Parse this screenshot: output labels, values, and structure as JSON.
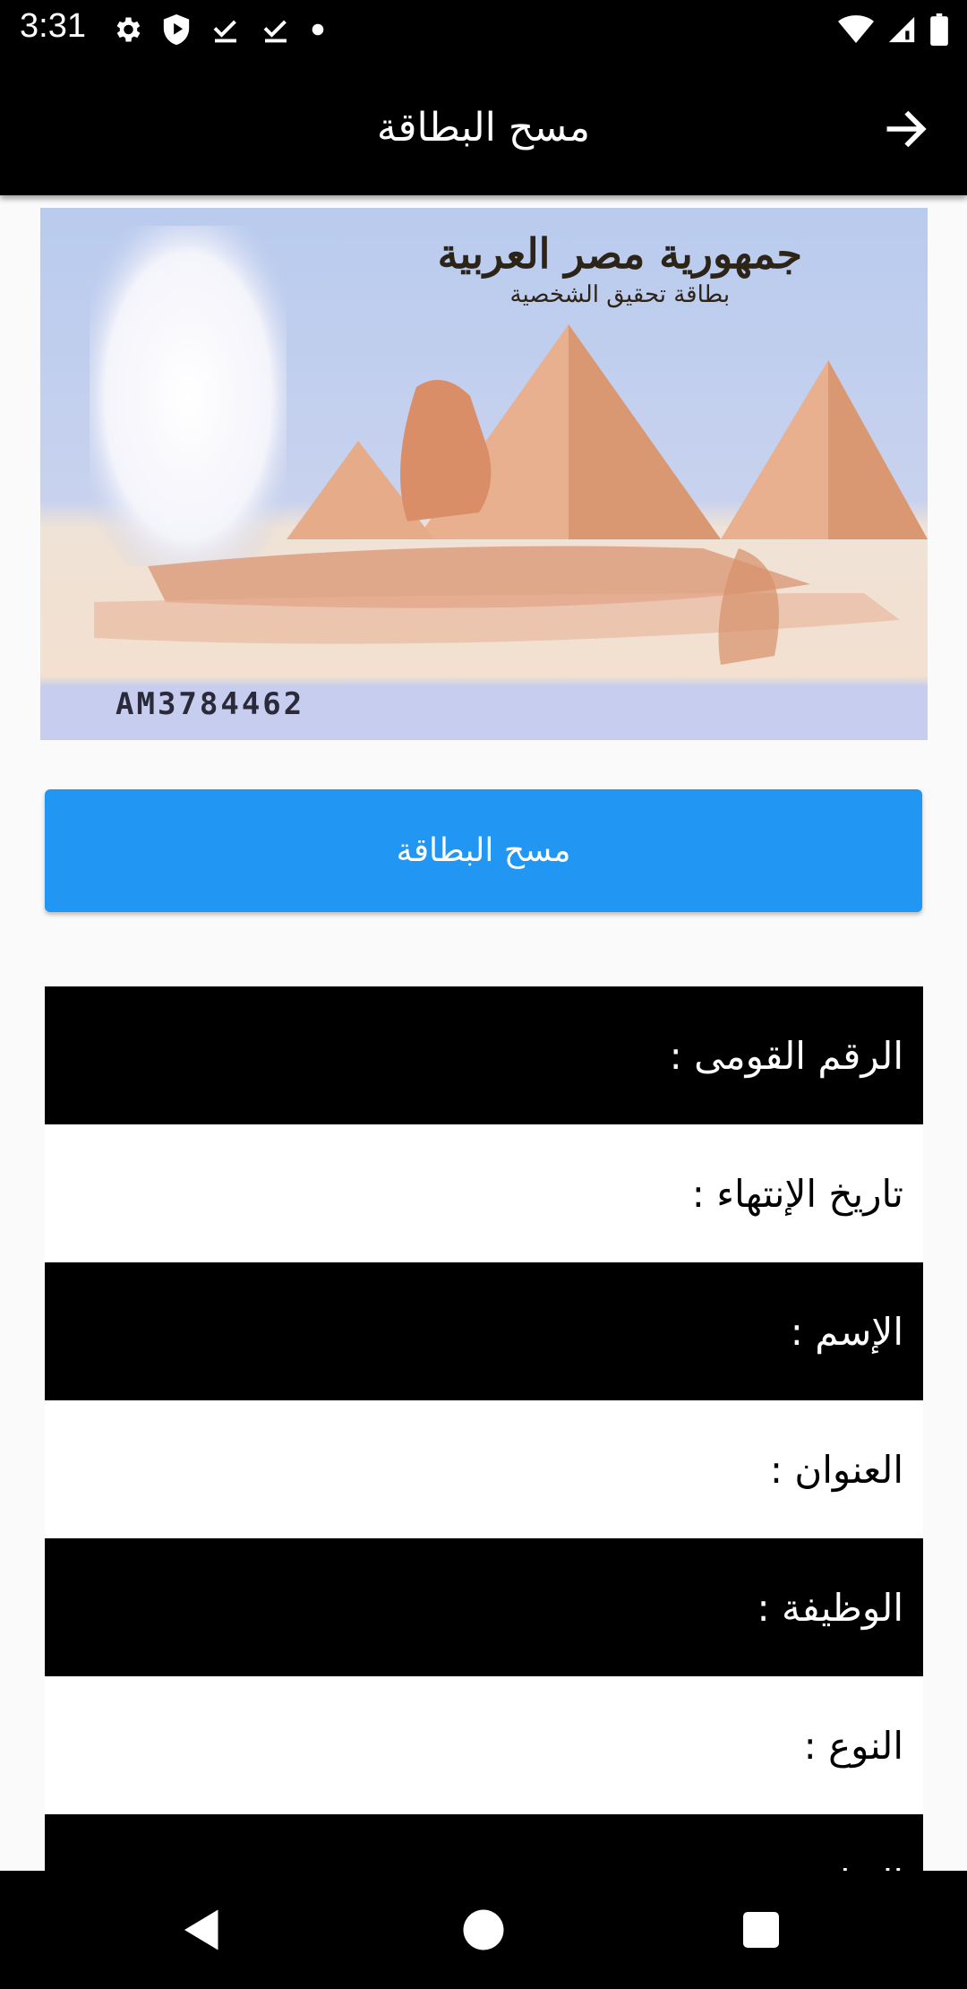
{
  "status_bar": {
    "time": "3:31",
    "left_icons": [
      "gear-icon",
      "shield-icon",
      "download-done-icon",
      "download-done-icon",
      "dot-icon"
    ],
    "right_icons": [
      "wifi-icon",
      "cell-signal-icon",
      "battery-icon"
    ]
  },
  "app_bar": {
    "title": "مسح البطاقة",
    "back_icon": "arrow-forward-icon"
  },
  "card_image": {
    "header_line1": "جمهورية مصر العربية",
    "header_line2": "بطاقة تحقيق الشخصية",
    "serial_number": "AM3784462"
  },
  "scan_button": {
    "label": "مسح البطاقة"
  },
  "fields": [
    {
      "label": "الرقم القومى :"
    },
    {
      "label": "تاريخ الإنتهاء :"
    },
    {
      "label": "الإسم :"
    },
    {
      "label": "العنوان :"
    },
    {
      "label": "الوظيفة :"
    },
    {
      "label": "النوع :"
    },
    {
      "label": "الديانة :"
    }
  ],
  "nav_bar": {
    "buttons": [
      "back-triangle-icon",
      "home-circle-icon",
      "recents-square-icon"
    ]
  },
  "colors": {
    "primary": "#2196f3",
    "app_bar": "#000000",
    "row_dark": "#000000",
    "row_light": "#ffffff",
    "background": "#fafafa"
  }
}
